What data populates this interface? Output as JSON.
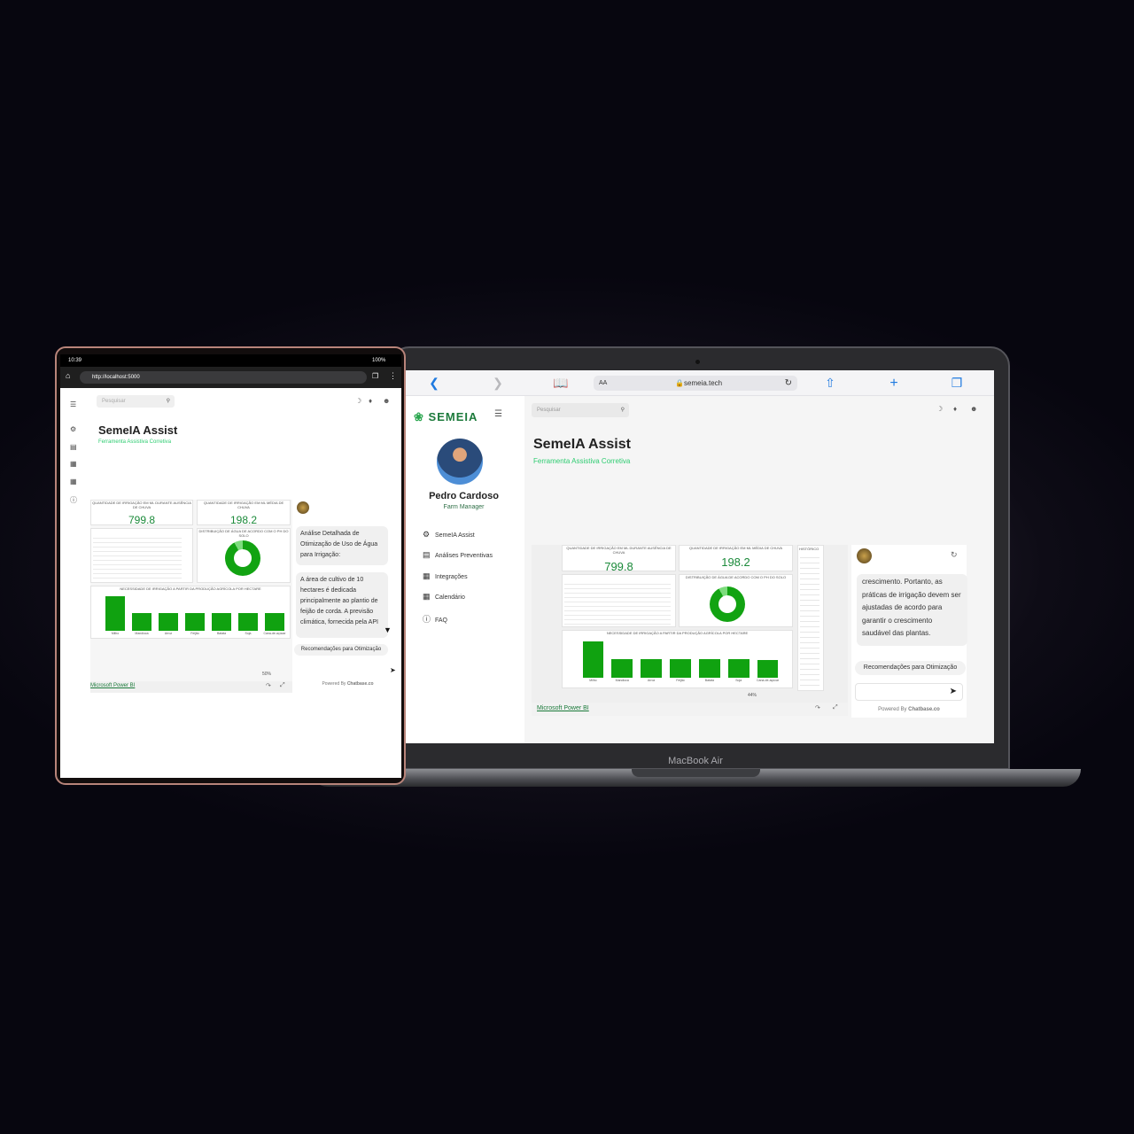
{
  "laptop": {
    "label": "MacBook Air",
    "browser": {
      "text_size": "AA",
      "url": "semeia.tech",
      "lock_icon": "lock-icon",
      "back_icon": "chevron-left-icon",
      "forward_icon": "chevron-right-icon",
      "book_icon": "book-icon",
      "reload_icon": "reload-icon",
      "share_icon": "share-icon",
      "plus_icon": "plus-icon",
      "tabs_icon": "tabs-icon"
    },
    "sidebar": {
      "logo": "SEMEIA",
      "user_name": "Pedro Cardoso",
      "user_role": "Farm Manager",
      "items": [
        {
          "label": "SemeIA Assist",
          "icon": "robot-icon"
        },
        {
          "label": "Análises Preventivas",
          "icon": "chart-icon"
        },
        {
          "label": "Integrações",
          "icon": "integration-icon"
        },
        {
          "label": "Calendário",
          "icon": "calendar-icon"
        },
        {
          "label": "FAQ",
          "icon": "help-icon"
        }
      ]
    },
    "search_placeholder": "Pesquisar",
    "page_title": "SemeIA Assist",
    "page_subtitle": "Ferramenta Assistiva Corretiva",
    "chat": {
      "message": "crescimento. Portanto, as práticas de irrigação devem ser ajustadas de acordo para garantir o crescimento saudável das plantas.",
      "suggestion": "Recomendações para Otimização",
      "powered_prefix": "Powered By ",
      "powered_brand": "Chatbase.co"
    },
    "zoom": "44%",
    "historico": "HISTÓRICO",
    "history_rows": 24
  },
  "dashboard": {
    "kpi1_title": "QUANTIDADE DE IRRIGAÇÃO EM ML DURANTE AUSÊNCIA DE CHUVA",
    "kpi1_value": "799.8",
    "kpi2_title": "QUANTIDADE DE IRRIGAÇÃO EM ML MÉDIA DE CHUVA",
    "kpi2_value": "198.2",
    "table_headers": [
      "Realização Irrita",
      "Temperatura",
      "Força vento",
      "Precipitação",
      "Umidade Relativa"
    ],
    "donut_title": "DISTRIBUIÇÃO DE ÁGUA DE ACORDO COM O PH DO SOLO",
    "bar_title": "NECESSIDADE DE IRRIGAÇÃO A PARTIR DA PRODUÇÃO AGRÍCOLA POR HECTARE",
    "powerbi_link": "Microsoft Power BI"
  },
  "chart_data": {
    "type": "bar",
    "title": "NECESSIDADE DE IRRIGAÇÃO A PARTIR DA PRODUÇÃO AGRÍCOLA POR HECTARE",
    "categories": [
      "Milho",
      "Mandioca",
      "Arroz",
      "Feijão",
      "Batata",
      "Soja",
      "Cana-de-açúcar"
    ],
    "values": [
      100,
      52,
      52,
      52,
      52,
      52,
      50
    ],
    "ylim": [
      0,
      110
    ]
  },
  "tablet": {
    "time": "10:39",
    "battery": "100%",
    "url": "http://localhost:5000",
    "search_placeholder": "Pesquisar",
    "page_title": "SemeIA Assist",
    "page_subtitle": "Ferramenta Assistiva Corretiva",
    "chat": {
      "message1": "Análise Detalhada de Otimização de Uso de Água para Irrigação:",
      "message2": "A área de cultivo de 10 hectares é dedicada principalmente ao plantio de feijão de corda. A previsão climática, fornecida pela API",
      "suggestion": "Recomendações para Otimização",
      "powered_prefix": "Powered By ",
      "powered_brand": "Chatbase.co"
    },
    "zoom": "50%"
  },
  "colors": {
    "accent": "#1b8a3a",
    "bar": "#10a210",
    "link": "#1f7ae0"
  }
}
